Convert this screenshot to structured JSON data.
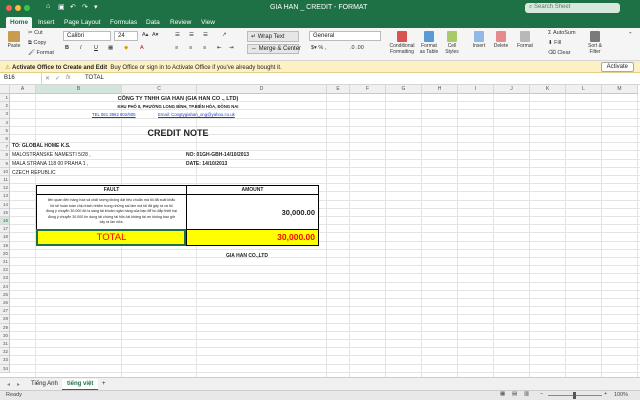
{
  "window": {
    "title": "GIA HAN _ CREDIT - FORMAT",
    "search_placeholder": "Search Sheet"
  },
  "tabs": [
    "Home",
    "Insert",
    "Page Layout",
    "Formulas",
    "Data",
    "Review",
    "View"
  ],
  "ribbon": {
    "paste": "Paste",
    "cut": "Cut",
    "copy": "Copy",
    "format": "Format",
    "font_name": "Calibri",
    "font_size": "24",
    "wrap_text": "Wrap Text",
    "merge_center": "Merge & Center",
    "number_format": "General",
    "conditional_formatting": "Conditional Formatting",
    "format_as_table": "Format as Table",
    "cell_styles": "Cell Styles",
    "insert": "Insert",
    "delete": "Delete",
    "format_cells": "Format",
    "autosum": "AutoSum",
    "fill": "Fill",
    "clear": "Clear",
    "sort_filter": "Sort & Filter"
  },
  "message_bar": {
    "title": "Activate Office to Create and Edit",
    "text": "Buy Office or sign in to Activate Office if you've already bought it.",
    "button": "Activate"
  },
  "formula_bar": {
    "cell_ref": "B16",
    "fx": "fx",
    "value": "TOTAL"
  },
  "columns": [
    "A",
    "B",
    "C",
    "D",
    "E",
    "F",
    "G",
    "H",
    "I",
    "J",
    "K",
    "L",
    "M",
    "N",
    "O",
    "P",
    "Q"
  ],
  "rows": [
    "1",
    "2",
    "3",
    "4",
    "5",
    "6",
    "7",
    "8",
    "9",
    "10",
    "11",
    "12",
    "13",
    "14",
    "15",
    "16",
    "17",
    "18",
    "19",
    "20",
    "21",
    "22",
    "23",
    "24",
    "25",
    "26",
    "27",
    "28",
    "29",
    "30",
    "31",
    "32",
    "33",
    "34"
  ],
  "document": {
    "company": "CÔNG TY TNHH GIA HAN  (GIA HAN CO ., LTD)",
    "address": "KHU PHỐ 8, PHƯỜNG LONG BÌNH, TP.BIÊN HÒA, ĐỒNG NAI",
    "tel": "TEL 061 3962 602/605",
    "email": "Email: Congtygiahan_ong@yahoo.co.uk",
    "heading": "CREDIT NOTE",
    "to": "TO: GLOBAL HOME K.S.",
    "addr1": "MALOSTRANSKE NAMESTI 5/28 ,",
    "addr2": "MALA STRANA 118 00 PRAHA 1 ,",
    "addr3": "CZECH REPUBLIC",
    "no": "NO: 01GH-GBH-14/10/2013",
    "date": "DATE: 14/10/2013",
    "fault_header": "FAULT",
    "amount_header": "AMOUNT",
    "fault_text_1": "liên quan đến hàng hóa và chất lượng không đạt tiêu chuẩn mà tôi đã xuất khẩu",
    "fault_text_2": "tôi sẽ hoàn toàn chịu trách nhiệm trong những sai lầm mà tôi đã gây ra và tôi",
    "fault_text_3": "đồng ý chuyển 30.000 đô la sang tài khoản ngân hàng của bạn để bù đắp thiệt hại",
    "fault_text_4": "đồng ý chuyển 30.000 tín dụng tài chứng tài hữu tài kháng tài ơn không bao giờ",
    "fault_text_5": "xảy ra lần nữa.",
    "amount_value": "30,000.00",
    "total_label": "TOTAL",
    "total_value": "30,000.00",
    "signature": "GIA HAN CO.,LTD"
  },
  "sheet_tabs": [
    "Tiếng Anh",
    "tiếng việt"
  ],
  "status": {
    "ready": "Ready",
    "zoom": "100%"
  },
  "colors": {
    "excel_green": "#1e7145",
    "total_fill": "#ffff00",
    "total_text": "#ff0000",
    "link": "#1f3fbf"
  }
}
